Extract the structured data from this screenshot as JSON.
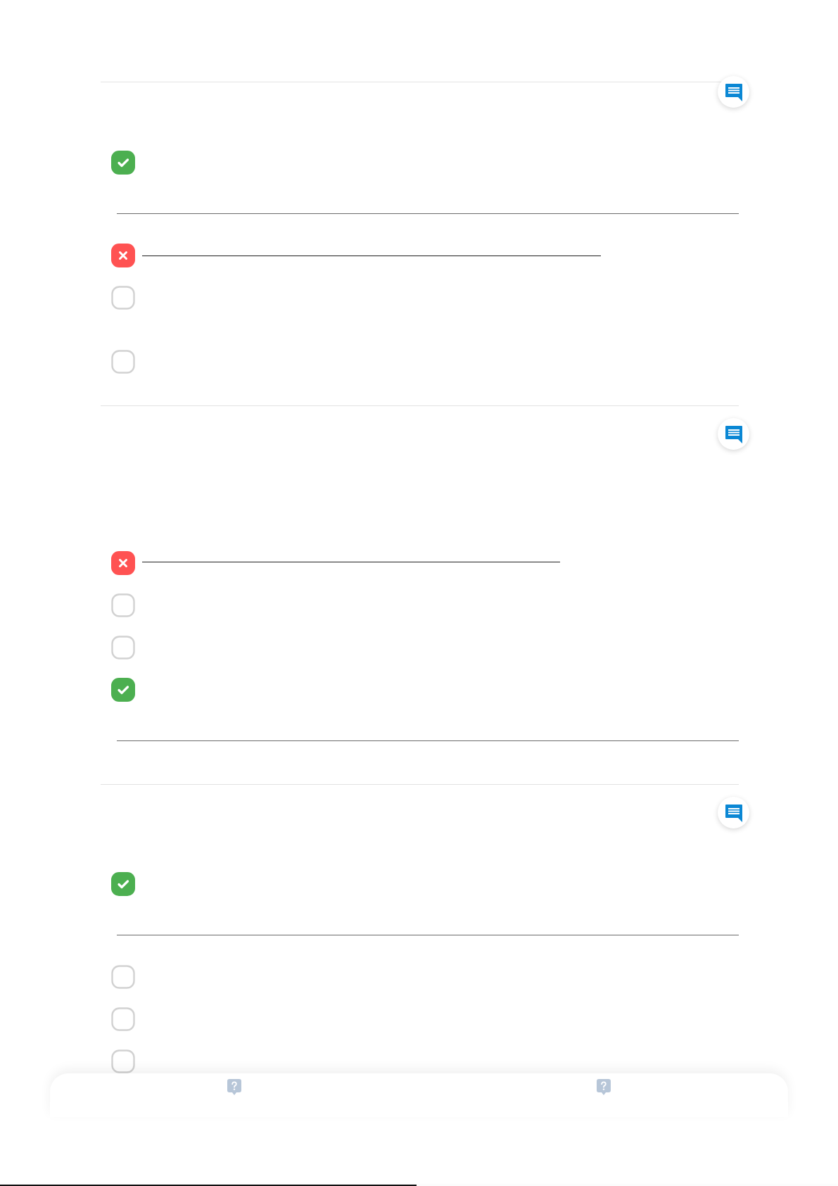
{
  "questions": [
    {
      "options": [
        {
          "kind": "correct"
        },
        {
          "kind": "wrong"
        },
        {
          "kind": "unanswered"
        },
        {
          "kind": "unanswered"
        }
      ]
    },
    {
      "options": [
        {
          "kind": "wrong"
        },
        {
          "kind": "unanswered"
        },
        {
          "kind": "unanswered"
        },
        {
          "kind": "correct"
        }
      ]
    },
    {
      "options": [
        {
          "kind": "correct"
        },
        {
          "kind": "unanswered"
        },
        {
          "kind": "unanswered"
        },
        {
          "kind": "unanswered"
        }
      ]
    }
  ],
  "progress_bar": {
    "level": 0.497
  }
}
